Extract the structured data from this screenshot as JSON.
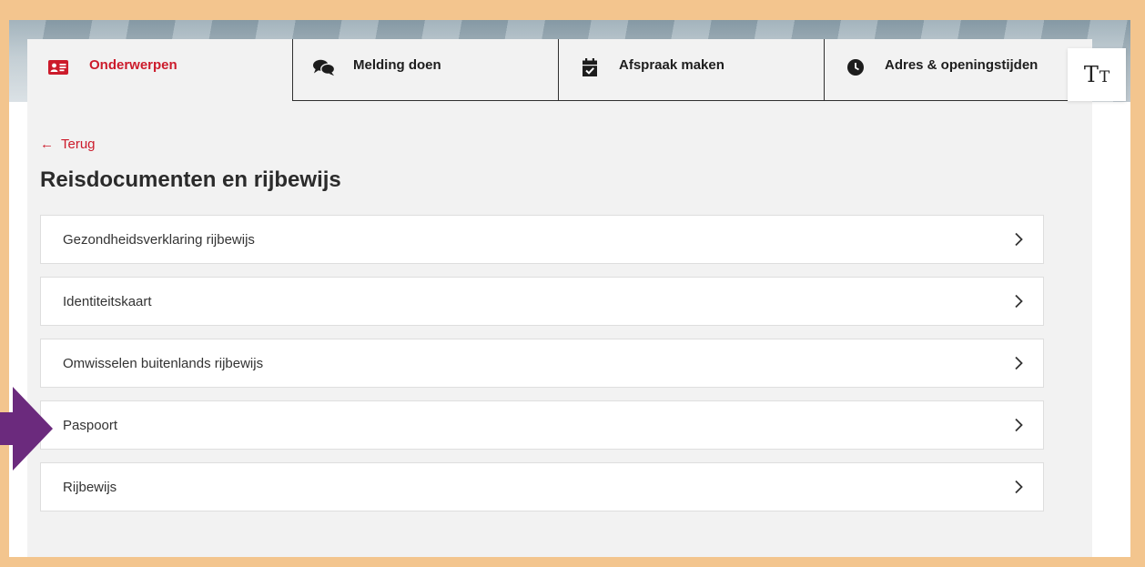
{
  "tabs": [
    {
      "label": "Onderwerpen",
      "icon": "id-card-icon",
      "active": true
    },
    {
      "label": "Melding doen",
      "icon": "chat-bubbles-icon",
      "active": false
    },
    {
      "label": "Afspraak maken",
      "icon": "calendar-check-icon",
      "active": false
    },
    {
      "label": "Adres & openingstijden",
      "icon": "clock-icon",
      "active": false
    }
  ],
  "text_size_button": {
    "icon": "text-size-icon"
  },
  "back": {
    "label": "Terug"
  },
  "page": {
    "title": "Reisdocumenten en rijbewijs"
  },
  "items": [
    {
      "label": "Gezondheidsverklaring rijbewijs"
    },
    {
      "label": "Identiteitskaart"
    },
    {
      "label": "Omwisselen buitenlands rijbewijs"
    },
    {
      "label": "Paspoort"
    },
    {
      "label": "Rijbewijs"
    }
  ],
  "colors": {
    "accent": "#cc1b2b",
    "frame": "#f3c58e",
    "panel": "#f2f2f2",
    "pointer": "#6b2a7d"
  }
}
